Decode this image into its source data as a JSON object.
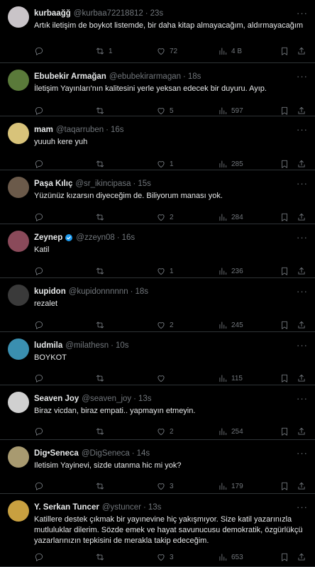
{
  "tweets": [
    {
      "name": "kurbaağğ",
      "handle": "@kurbaa72218812",
      "time": "23s",
      "text": "Artık iletişim de boykot listemde, bir daha kitap almayacağım, aldırmayacağım",
      "replies": "",
      "retweets": "1",
      "likes": "72",
      "views": "4 B",
      "avatar_color": "#c9c4c8",
      "verified": false
    },
    {
      "name": "Ebubekir Armağan",
      "handle": "@ebubekirarmagan",
      "time": "18s",
      "text": "İletişim Yayınları'nın kalitesini yerle yeksan edecek bir duyuru. Ayıp.",
      "replies": "",
      "retweets": "",
      "likes": "5",
      "views": "597",
      "avatar_color": "#5a7a3a",
      "verified": false
    },
    {
      "name": "mam",
      "handle": "@taqarruben",
      "time": "16s",
      "text": "yuuuh kere yuh",
      "replies": "",
      "retweets": "",
      "likes": "1",
      "views": "285",
      "avatar_color": "#d8c37a",
      "verified": false
    },
    {
      "name": "Paşa Kılıç",
      "handle": "@sr_ikincipasa",
      "time": "15s",
      "text": "Yüzünüz kızarsın diyeceğim de. Biliyorum manası yok.",
      "replies": "",
      "retweets": "",
      "likes": "2",
      "views": "284",
      "avatar_color": "#6b5a4a",
      "verified": false
    },
    {
      "name": "Zeynep",
      "handle": "@zzeyn08",
      "time": "16s",
      "text": "Katil",
      "replies": "",
      "retweets": "",
      "likes": "1",
      "views": "236",
      "avatar_color": "#8a4a5a",
      "verified": true
    },
    {
      "name": "kupidon",
      "handle": "@kupidonnnnnn",
      "time": "18s",
      "text": "rezalet",
      "replies": "",
      "retweets": "",
      "likes": "2",
      "views": "245",
      "avatar_color": "#3a3a3a",
      "verified": false
    },
    {
      "name": "ludmila",
      "handle": "@milathesn",
      "time": "10s",
      "text": "BOYKOT",
      "replies": "",
      "retweets": "",
      "likes": "",
      "views": "115",
      "avatar_color": "#3a8fb0",
      "verified": false
    },
    {
      "name": "Seaven Joy",
      "handle": "@seaven_joy",
      "time": "13s",
      "text": "Biraz vicdan, biraz empati.. yapmayın etmeyin.",
      "replies": "",
      "retweets": "",
      "likes": "2",
      "views": "254",
      "avatar_color": "#d0d0d0",
      "verified": false
    },
    {
      "name": "Dig•Seneca",
      "handle": "@DigSeneca",
      "time": "14s",
      "text": "Iletisim Yayinevi, sizde utanma hic mi yok?",
      "replies": "",
      "retweets": "",
      "likes": "3",
      "views": "179",
      "avatar_color": "#a89a70",
      "verified": false
    },
    {
      "name": "Y. Serkan Tuncer",
      "handle": "@ystuncer",
      "time": "13s",
      "text": "Katillere destek çıkmak bir yayınevine hiç yakışmıyor. Size katil yazarınızla mutluluklar dilerim. Sözde emek ve hayat savunucusu demokratik, özgürlükçü yazarlarınızın tepkisini de merakla takip edeceğim.",
      "replies": "",
      "retweets": "",
      "likes": "3",
      "views": "653",
      "avatar_color": "#c8a040",
      "verified": false
    }
  ],
  "colors": {
    "background": "#000000",
    "text": "#e7e9ea",
    "muted": "#71767b",
    "divider": "#2f3336",
    "verified": "#1d9bf0"
  },
  "icons": [
    "reply-icon",
    "retweet-icon",
    "like-icon",
    "views-icon",
    "bookmark-icon",
    "share-icon",
    "more-icon",
    "verified-icon"
  ]
}
